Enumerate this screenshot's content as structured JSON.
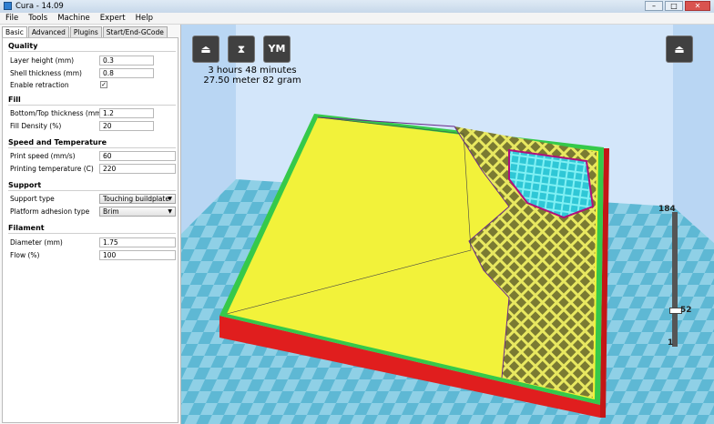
{
  "window": {
    "title": "Cura - 14.09"
  },
  "menu": [
    "File",
    "Tools",
    "Machine",
    "Expert",
    "Help"
  ],
  "tabs": [
    "Basic",
    "Advanced",
    "Plugins",
    "Start/End-GCode"
  ],
  "sections": {
    "quality": {
      "title": "Quality",
      "layer_height": {
        "label": "Layer height (mm)",
        "value": "0.3"
      },
      "shell_thickness": {
        "label": "Shell thickness (mm)",
        "value": "0.8"
      },
      "enable_retraction": {
        "label": "Enable retraction",
        "checked_glyph": "✓"
      }
    },
    "fill": {
      "title": "Fill",
      "bottom_top": {
        "label": "Bottom/Top thickness (mm)",
        "value": "1.2"
      },
      "density": {
        "label": "Fill Density (%)",
        "value": "20"
      }
    },
    "speed": {
      "title": "Speed and Temperature",
      "print_speed": {
        "label": "Print speed (mm/s)",
        "value": "60"
      },
      "temp": {
        "label": "Printing temperature (C)",
        "value": "220"
      }
    },
    "support": {
      "title": "Support",
      "support_type": {
        "label": "Support type",
        "value": "Touching buildplate"
      },
      "adhesion": {
        "label": "Platform adhesion type",
        "value": "Brim"
      }
    },
    "filament": {
      "title": "Filament",
      "diameter": {
        "label": "Diameter (mm)",
        "value": "1.75"
      },
      "flow": {
        "label": "Flow (%)",
        "value": "100"
      }
    }
  },
  "viewport": {
    "buttons": {
      "load": "load-icon",
      "save": "save-print-icon",
      "youmagine": "YM",
      "view_mode": "view-mode-icon"
    },
    "estimate_time": "3 hours 48 minutes",
    "estimate_material": "27.50 meter 82 gram",
    "layers": {
      "max": "184",
      "current": "52",
      "min": "1",
      "current_fraction": 0.28
    }
  }
}
